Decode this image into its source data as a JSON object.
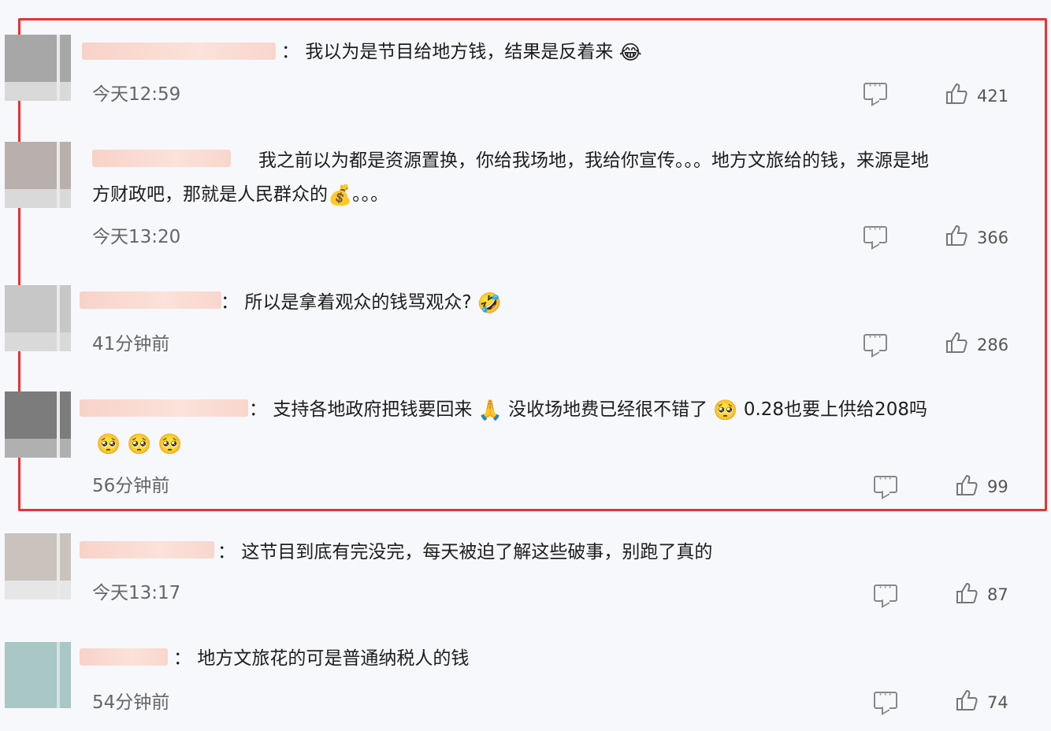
{
  "comments": [
    {
      "text": "我以为是节目给地方钱，结果是反着来",
      "emoji": "😂",
      "time": "今天12:59",
      "likes": "421"
    },
    {
      "text_line1": "我之前以为都是资源置换，你给我场地，我给你宣传。。。地方文旅给的钱，来源是地",
      "text_line2_a": "方财政吧，那就是人民群众的",
      "emoji": "💰",
      "text_line2_b": "。。。",
      "time": "今天13:20",
      "likes": "366"
    },
    {
      "text": "所以是拿着观众的钱骂观众?",
      "emoji": "🤣",
      "time": "41分钟前",
      "likes": "286"
    },
    {
      "text_a": "支持各地政府把钱要回来",
      "emoji_a": "🙏",
      "text_b": "没收场地费已经很不错了",
      "emoji_b": "🥺",
      "text_c": "0.28也要上供给208吗",
      "emoji_line2": "🥺 🥺 🥺",
      "time": "56分钟前",
      "likes": "99"
    },
    {
      "text": "这节目到底有完没完，每天被迫了解这些破事，别跑了真的",
      "time": "今天13:17",
      "likes": "87"
    },
    {
      "text": "地方文旅花的可是普通纳税人的钱",
      "time": "54分钟前",
      "likes": "74"
    }
  ],
  "colors": {
    "highlight_border": "#e8322f",
    "name_blur": "#f8d2c8",
    "icon_gray": "#888888"
  },
  "icons": {
    "reply": "comment-bubble-icon",
    "like": "thumbs-up-icon"
  }
}
